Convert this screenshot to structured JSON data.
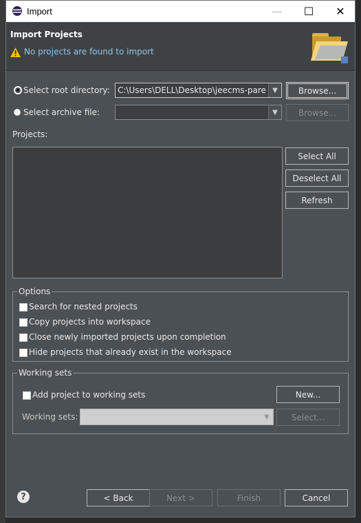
{
  "window": {
    "title": "Import",
    "minimize_glyph": "—",
    "maximize_glyph": "☐",
    "close_glyph": "✕"
  },
  "header": {
    "title": "Import Projects",
    "message": "No projects are found to import"
  },
  "source": {
    "root_dir_label": "Select root directory:",
    "root_dir_value": "C:\\Users\\DELL\\Desktop\\jeecms-parent",
    "archive_label": "Select archive file:",
    "archive_value": "",
    "browse_label": "Browse...",
    "browse_disabled_label": "Browse...",
    "selected": "root"
  },
  "projects": {
    "label": "Projects:",
    "items": [],
    "select_all": "Select All",
    "deselect_all": "Deselect All",
    "refresh": "Refresh"
  },
  "options": {
    "title": "Options",
    "items": [
      {
        "label": "Search for nested projects",
        "checked": false
      },
      {
        "label": "Copy projects into workspace",
        "checked": false
      },
      {
        "label": "Close newly imported projects upon completion",
        "checked": false
      },
      {
        "label": "Hide projects that already exist in the workspace",
        "checked": false
      }
    ]
  },
  "working_sets": {
    "title": "Working sets",
    "add_label": "Add project to working sets",
    "new_button": "New...",
    "sets_label": "Working sets:",
    "select_button": "Select..."
  },
  "footer": {
    "help_glyph": "?",
    "back": "< Back",
    "next": "Next >",
    "finish": "Finish",
    "cancel": "Cancel"
  },
  "colors": {
    "dialog_bg": "#4b5054",
    "header_bg": "#3e4245",
    "message_blue": "#8fc7e6",
    "warning_yellow": "#f2c200"
  }
}
